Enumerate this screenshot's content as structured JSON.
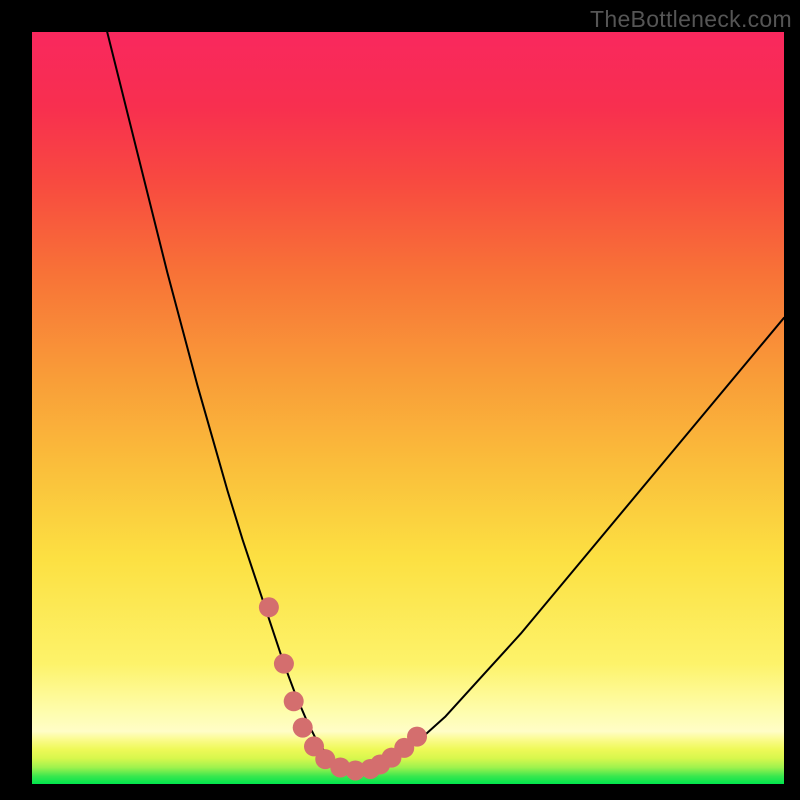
{
  "watermark": "TheBottleneck.com",
  "chart_data": {
    "type": "line",
    "title": "",
    "xlabel": "",
    "ylabel": "",
    "xlim": [
      0,
      100
    ],
    "ylim": [
      0,
      100
    ],
    "grid": false,
    "legend": false,
    "series": [
      {
        "name": "bottleneck-curve",
        "stroke": "#000000",
        "stroke_width": 2,
        "x": [
          10,
          12,
          14,
          16,
          18,
          20,
          22,
          24,
          26,
          28,
          30,
          32,
          33.5,
          35,
          36.5,
          38,
          40,
          42,
          44,
          46,
          50,
          55,
          60,
          65,
          70,
          75,
          80,
          85,
          90,
          95,
          100
        ],
        "y": [
          100,
          92,
          84,
          76,
          68,
          60.5,
          53,
          46,
          39,
          32.5,
          26.5,
          20.5,
          16,
          12,
          8.5,
          5.5,
          3,
          2,
          1.6,
          2.2,
          4.5,
          9,
          14.5,
          20,
          26,
          32,
          38,
          44,
          50,
          56,
          62
        ]
      },
      {
        "name": "highlight-dots",
        "type": "scatter",
        "fill": "#d46e6e",
        "radius": 10,
        "x": [
          31.5,
          33.5,
          34.8,
          36,
          37.5,
          39,
          41,
          43,
          45,
          46.3,
          47.8,
          49.5,
          51.2
        ],
        "y": [
          23.5,
          16,
          11,
          7.5,
          5,
          3.3,
          2.2,
          1.8,
          2,
          2.6,
          3.5,
          4.8,
          6.3
        ]
      }
    ],
    "background_gradient": {
      "direction": "vertical",
      "stops": [
        {
          "pos": 0.0,
          "color": "#f9285e"
        },
        {
          "pos": 0.2,
          "color": "#f84a40"
        },
        {
          "pos": 0.45,
          "color": "#f99a38"
        },
        {
          "pos": 0.7,
          "color": "#fce042"
        },
        {
          "pos": 0.9,
          "color": "#fefdae"
        },
        {
          "pos": 0.95,
          "color": "#d7f74d"
        },
        {
          "pos": 1.0,
          "color": "#00e54d"
        }
      ]
    }
  }
}
